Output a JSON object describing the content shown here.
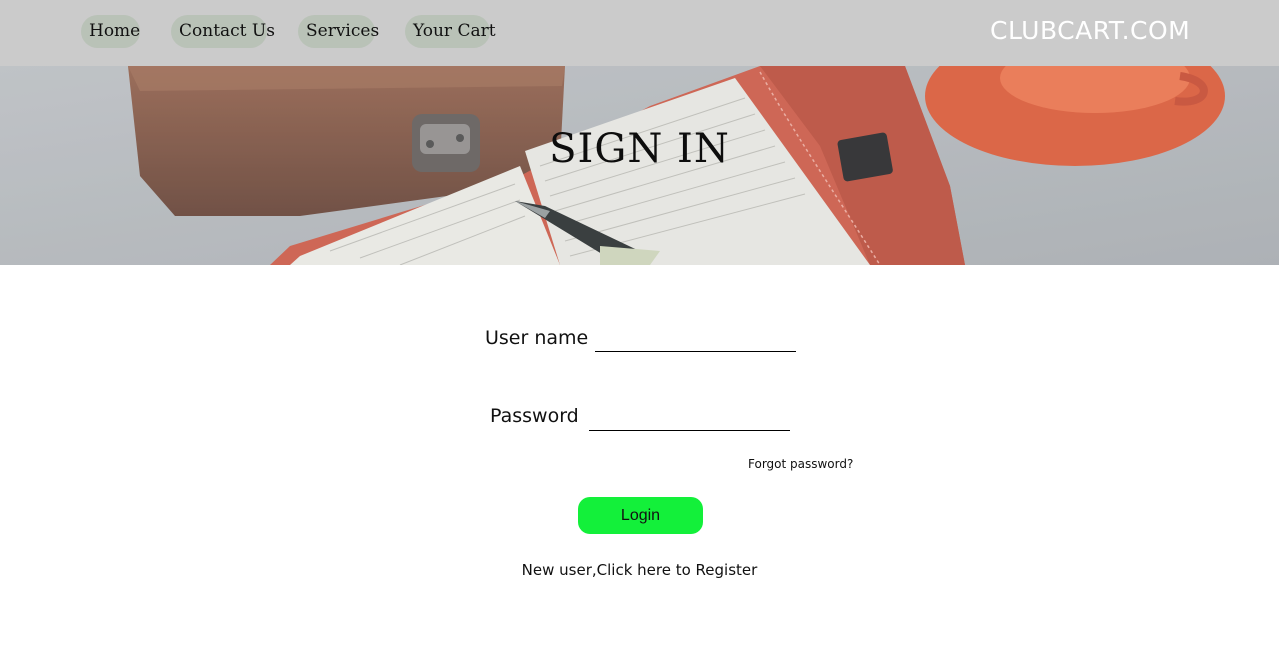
{
  "nav": {
    "items": [
      {
        "label": "Home"
      },
      {
        "label": "Contact Us"
      },
      {
        "label": "Services"
      },
      {
        "label": "Your Cart"
      }
    ],
    "brand": "CLUBCART.COM"
  },
  "hero": {
    "title": "SIGN IN"
  },
  "form": {
    "username_label": "User name",
    "username_value": "",
    "password_label": "Password",
    "password_value": "",
    "forgot_link": "Forgot password?",
    "login_button": "Login",
    "register_link": "New user,Click here to Register"
  },
  "colors": {
    "nav_bar": "#cbcbcb",
    "nav_pill": "#b9c2b7",
    "login_button": "#13f03a",
    "brand_text": "#ffffff"
  }
}
